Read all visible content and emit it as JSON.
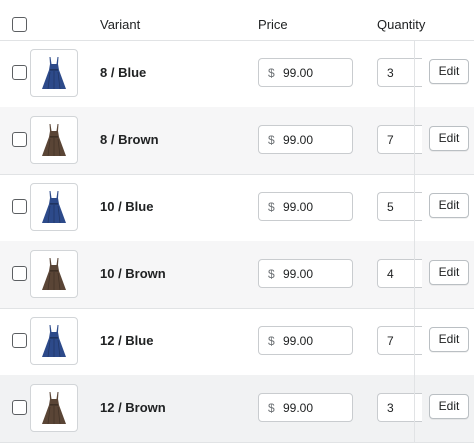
{
  "table": {
    "headers": {
      "variant": "Variant",
      "price": "Price",
      "quantity": "Quantity"
    },
    "currency_symbol": "$",
    "edit_label": "Edit",
    "rows": [
      {
        "variant": "8 / Blue",
        "color": "#2d4a8a",
        "price": "99.00",
        "quantity": "3"
      },
      {
        "variant": "8 / Brown",
        "color": "#5a4536",
        "price": "99.00",
        "quantity": "7"
      },
      {
        "variant": "10 / Blue",
        "color": "#2d4a8a",
        "price": "99.00",
        "quantity": "5"
      },
      {
        "variant": "10 / Brown",
        "color": "#5a4536",
        "price": "99.00",
        "quantity": "4"
      },
      {
        "variant": "12 / Blue",
        "color": "#2d4a8a",
        "price": "99.00",
        "quantity": "7"
      },
      {
        "variant": "12 / Brown",
        "color": "#5a4536",
        "price": "99.00",
        "quantity": "3"
      }
    ]
  }
}
